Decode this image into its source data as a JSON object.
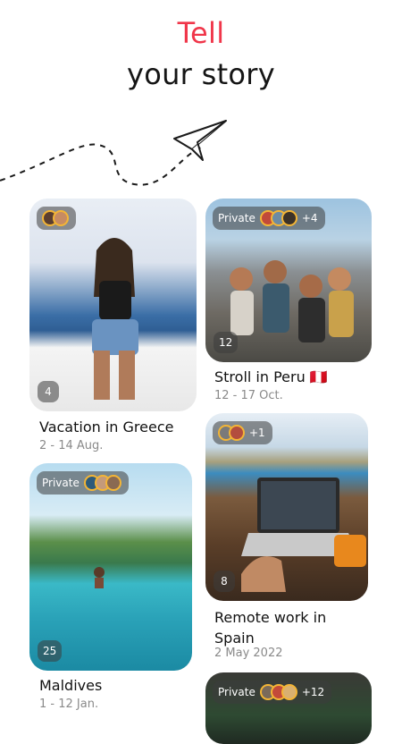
{
  "hero": {
    "line1": "Tell",
    "line2": "your story"
  },
  "cards": [
    {
      "title": "Vacation in Greece",
      "date": "2 - 14 Aug.",
      "count": "4",
      "privacy": "",
      "extra": ""
    },
    {
      "title": "Stroll in Peru",
      "flag": "🇵🇪",
      "date": "12 - 17 Oct.",
      "count": "12",
      "privacy": "Private",
      "extra": "+4"
    },
    {
      "title": "Remote work in Spain",
      "title_l1": "Remote work in",
      "title_l2": "Spain",
      "date": "2 May 2022",
      "count": "8",
      "privacy": "",
      "extra": "+1"
    },
    {
      "title": "Maldives",
      "date": "1 - 12 Jan.",
      "count": "25",
      "privacy": "Private",
      "extra": ""
    },
    {
      "title": "",
      "date": "",
      "count": "",
      "privacy": "Private",
      "extra": "+12"
    }
  ],
  "colors": {
    "accent": "#f0364a",
    "avatar_ring": "#f3b536"
  },
  "icons": [
    "paper-plane-icon"
  ]
}
